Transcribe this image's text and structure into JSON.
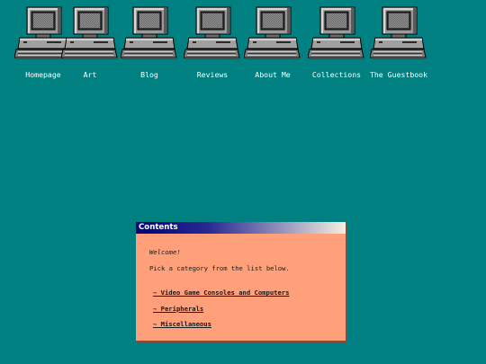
{
  "desktop": {
    "icons": [
      {
        "label": "Homepage",
        "icon": "computer-icon"
      },
      {
        "label": "Art",
        "icon": "computer-icon"
      },
      {
        "label": "Blog",
        "icon": "computer-icon"
      },
      {
        "label": "Reviews",
        "icon": "computer-icon"
      },
      {
        "label": "About Me",
        "icon": "computer-icon"
      },
      {
        "label": "Collections",
        "icon": "computer-icon"
      },
      {
        "label": "The Guestbook",
        "icon": "computer-icon"
      }
    ],
    "background_color": "#008080"
  },
  "contents_window": {
    "title": "Contents",
    "welcome": "Welcome!",
    "intro": "Pick a category from the list below.",
    "categories": [
      "~ Video Game Consoles and Computers",
      "~ Peripherals",
      "~ Miscellaneous"
    ],
    "background_color": "#ffa07a"
  }
}
